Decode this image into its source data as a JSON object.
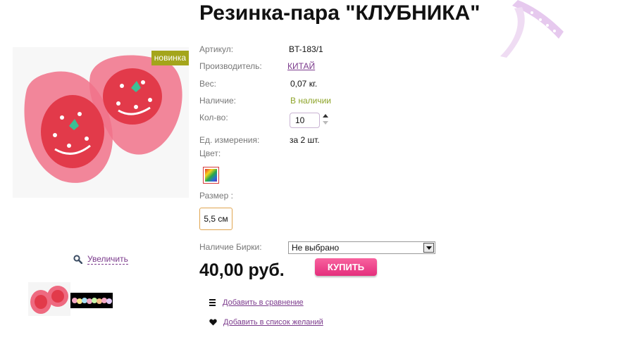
{
  "product": {
    "title": "Резинка-пара \"КЛУБНИКА\"",
    "badge": "новинка",
    "zoom_label": "Увеличить"
  },
  "attributes": [
    {
      "label": "Артикул:",
      "value": "BT-183/1"
    },
    {
      "label": "Производитель:",
      "value": "КИТАЙ"
    },
    {
      "label": "Вес:",
      "value": "0,07 кг."
    },
    {
      "label": "Наличие:",
      "value": "В наличии"
    },
    {
      "label": "Кол-во:",
      "value": "10"
    },
    {
      "label": "Ед. измерения:",
      "value": "за 2 шт."
    }
  ],
  "color_label": "Цвет:",
  "size_label": "Размер :",
  "size_option": "5,5 см",
  "tag": {
    "label": "Наличие Бирки:",
    "selected": "Не выбрано"
  },
  "price": "40,00 руб.",
  "buy_label": "КУПИТЬ",
  "actions": {
    "compare": "Добавить в сравнение",
    "wishlist": "Добавить в список желаний"
  },
  "colors": {
    "link": "#7b3a8c",
    "in_stock": "#8ea42a",
    "buy_button": "#e42f7c",
    "badge": "#a4a51b"
  }
}
